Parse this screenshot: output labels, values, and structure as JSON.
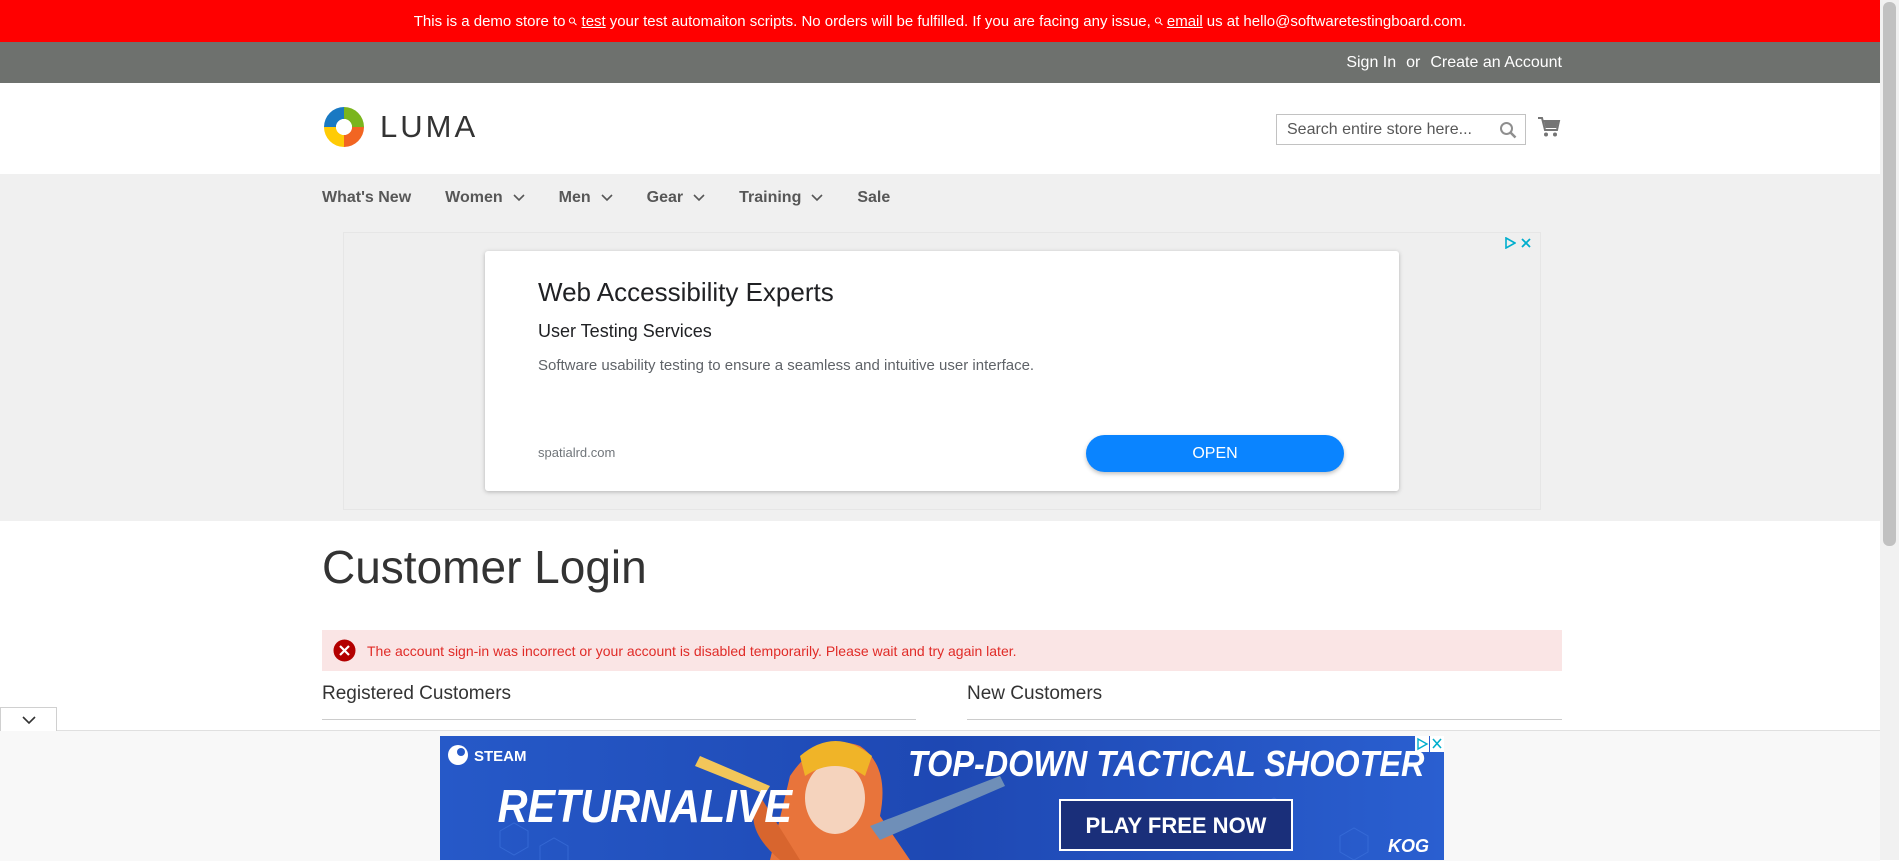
{
  "demo_notice": {
    "prefix": "This is a demo store to",
    "link1": "test",
    "middle": "your test automaiton scripts. No orders will be fulfilled. If you are facing any issue,",
    "link2": "email",
    "suffix": "us at hello@softwaretestingboard.com."
  },
  "header": {
    "sign_in": "Sign In",
    "or": "or",
    "create_account": "Create an Account",
    "logo_text": "LUMA",
    "search_placeholder": "Search entire store here..."
  },
  "nav": {
    "items": [
      {
        "label": "What's New",
        "has_menu": false
      },
      {
        "label": "Women",
        "has_menu": true
      },
      {
        "label": "Men",
        "has_menu": true
      },
      {
        "label": "Gear",
        "has_menu": true
      },
      {
        "label": "Training",
        "has_menu": true
      },
      {
        "label": "Sale",
        "has_menu": false
      }
    ]
  },
  "ad": {
    "title": "Web Accessibility Experts",
    "subtitle": "User Testing Services",
    "description": "Software usability testing to ensure a seamless and intuitive user interface.",
    "domain": "spatialrd.com",
    "button": "OPEN"
  },
  "page": {
    "title": "Customer Login",
    "error": "The account sign-in was incorrect or your account is disabled temporarily. Please wait and try again later.",
    "registered_title": "Registered Customers",
    "new_title": "New Customers"
  },
  "bottom_ad": {
    "brand": "STEAM",
    "game": "RETURNALIVE",
    "headline": "TOP-DOWN TACTICAL SHOOTER",
    "cta": "PLAY FREE NOW",
    "publisher": "KOG"
  },
  "colors": {
    "demo_bar": "#ff0000",
    "header_links_bg": "#6e716e",
    "nav_bg": "#f0f0f0",
    "error_bg": "#fae5e5",
    "error_text": "#e02b27",
    "ad_button": "#0a84ff"
  }
}
